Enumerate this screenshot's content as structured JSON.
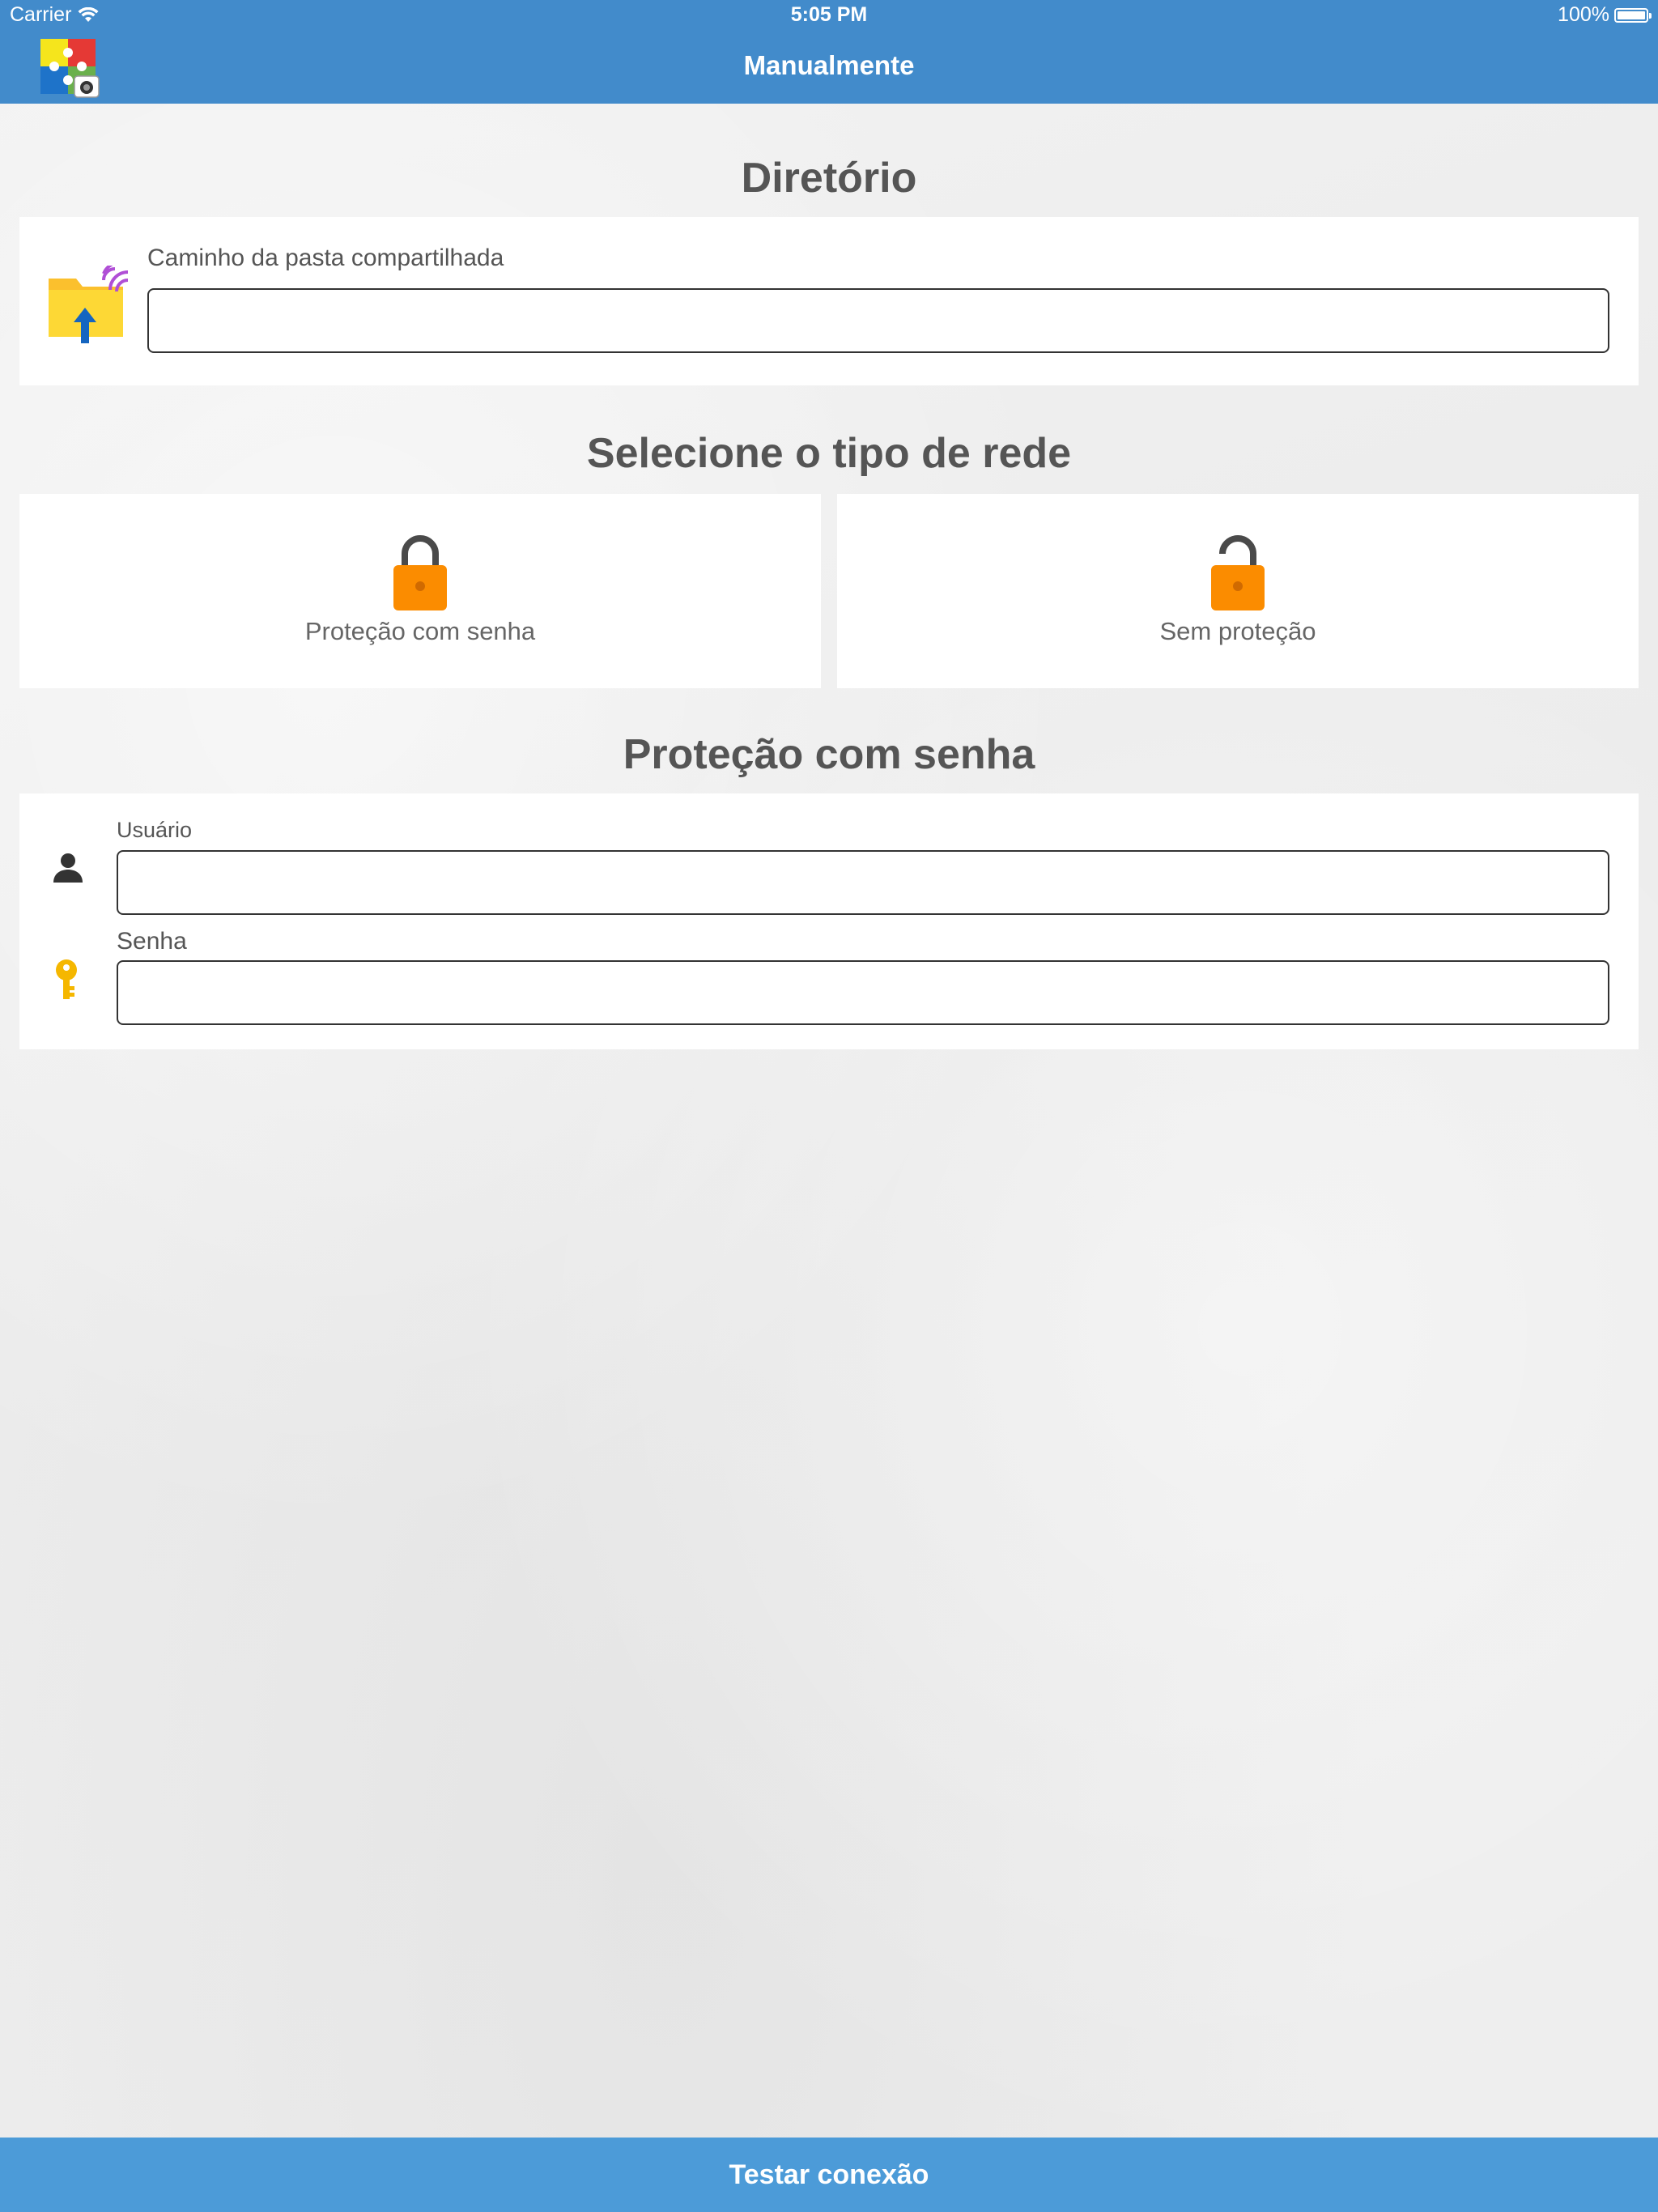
{
  "status_bar": {
    "carrier": "Carrier",
    "time": "5:05 PM",
    "battery": "100%"
  },
  "nav": {
    "title": "Manualmente",
    "logo_icon": "app-logo-puzzle-camera-icon"
  },
  "directory_section": {
    "title": "Diretório",
    "path_label": "Caminho da pasta compartilhada",
    "path_value": "",
    "folder_icon": "shared-folder-upload-icon"
  },
  "network_section": {
    "title": "Selecione o tipo de rede",
    "options": [
      {
        "label": "Proteção com senha",
        "icon": "lock-closed-icon"
      },
      {
        "label": "Sem proteção",
        "icon": "lock-open-icon"
      }
    ]
  },
  "credentials_section": {
    "title": "Proteção com senha",
    "user_label": "Usuário",
    "user_value": "",
    "password_label": "Senha",
    "password_value": "",
    "user_icon": "person-icon",
    "key_icon": "key-icon"
  },
  "footer": {
    "test_button_label": "Testar conexão"
  },
  "colors": {
    "header_blue": "#428bcb",
    "button_blue": "#4c9bd8",
    "lock_orange": "#fb8c00",
    "folder_yellow": "#fbc02d",
    "key_yellow": "#f5b700"
  }
}
